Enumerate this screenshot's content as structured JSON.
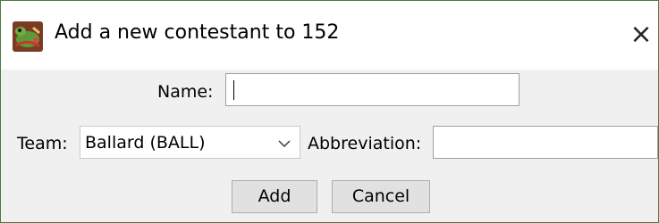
{
  "window": {
    "title": "Add a new contestant to 152",
    "close_glyph": "×",
    "app_icon": "frog-app-icon"
  },
  "form": {
    "name_label": "Name:",
    "name_value": "",
    "team_label": "Team:",
    "team_selected": "Ballard (BALL)",
    "abbreviation_label": "Abbreviation:",
    "abbreviation_value": ""
  },
  "buttons": {
    "add": "Add",
    "cancel": "Cancel"
  },
  "colors": {
    "window_border": "#4d7a3e",
    "content_background": "#f0f0f0",
    "button_face": "#e1e1e1"
  }
}
